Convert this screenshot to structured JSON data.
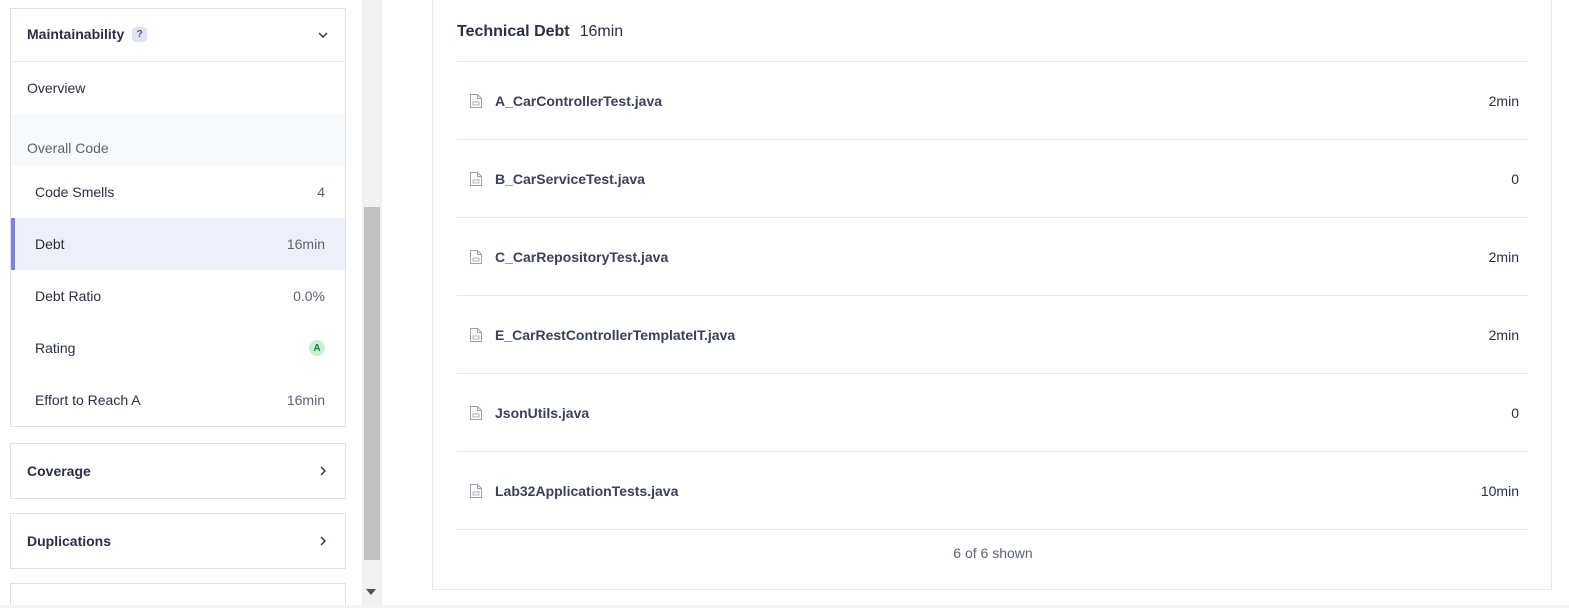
{
  "sidebar": {
    "maintainability": {
      "title": "Maintainability",
      "help": "?",
      "overview": "Overview",
      "section": "Overall Code",
      "metrics": [
        {
          "label": "Code Smells",
          "value": "4"
        },
        {
          "label": "Debt",
          "value": "16min"
        },
        {
          "label": "Debt Ratio",
          "value": "0.0%"
        },
        {
          "label": "Rating",
          "value": "A"
        },
        {
          "label": "Effort to Reach A",
          "value": "16min"
        }
      ]
    },
    "coverage": {
      "title": "Coverage"
    },
    "duplications": {
      "title": "Duplications"
    }
  },
  "main": {
    "title": "Technical Debt",
    "total": "16min",
    "files": [
      {
        "name": "A_CarControllerTest.java",
        "value": "2min"
      },
      {
        "name": "B_CarServiceTest.java",
        "value": "0"
      },
      {
        "name": "C_CarRepositoryTest.java",
        "value": "2min"
      },
      {
        "name": "E_CarRestControllerTemplateIT.java",
        "value": "2min"
      },
      {
        "name": "JsonUtils.java",
        "value": "0"
      },
      {
        "name": "Lab32ApplicationTests.java",
        "value": "10min"
      }
    ],
    "shown": "6 of 6 shown"
  },
  "colors": {
    "accent": "#7a83d6",
    "active_bg": "#edf0fa",
    "rating_bg": "#c7f1d2",
    "rating_fg": "#1c7a3a"
  }
}
